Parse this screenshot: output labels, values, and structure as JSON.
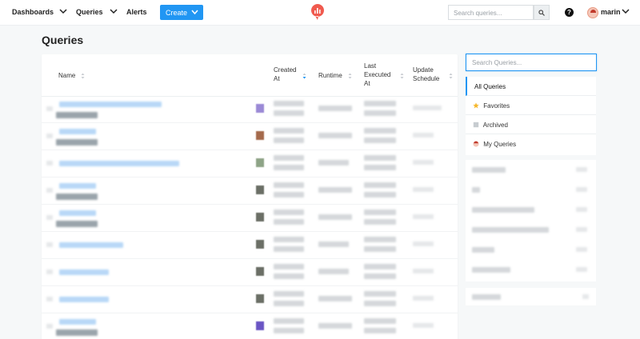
{
  "nav": {
    "dashboards": "Dashboards",
    "queries": "Queries",
    "alerts": "Alerts",
    "create": "Create",
    "search_placeholder": "Search queries...",
    "help": "?",
    "user": "marin",
    "logo_color": "#f05a4e"
  },
  "page": {
    "title": "Queries"
  },
  "table": {
    "columns": {
      "name": "Name",
      "created_at": "Created At",
      "runtime": "Runtime",
      "last_executed_at": "Last Executed At",
      "update_schedule": "Update Schedule"
    }
  },
  "sidebar": {
    "search_placeholder": "Search Queries...",
    "items": [
      {
        "label": "All Queries",
        "icon": "none",
        "active": true
      },
      {
        "label": "Favorites",
        "icon": "star-icon"
      },
      {
        "label": "Archived",
        "icon": "archive-icon"
      },
      {
        "label": "My Queries",
        "icon": "avatar-icon"
      }
    ]
  },
  "colors": {
    "accent": "#2196f3",
    "background": "#f6f8f9"
  }
}
